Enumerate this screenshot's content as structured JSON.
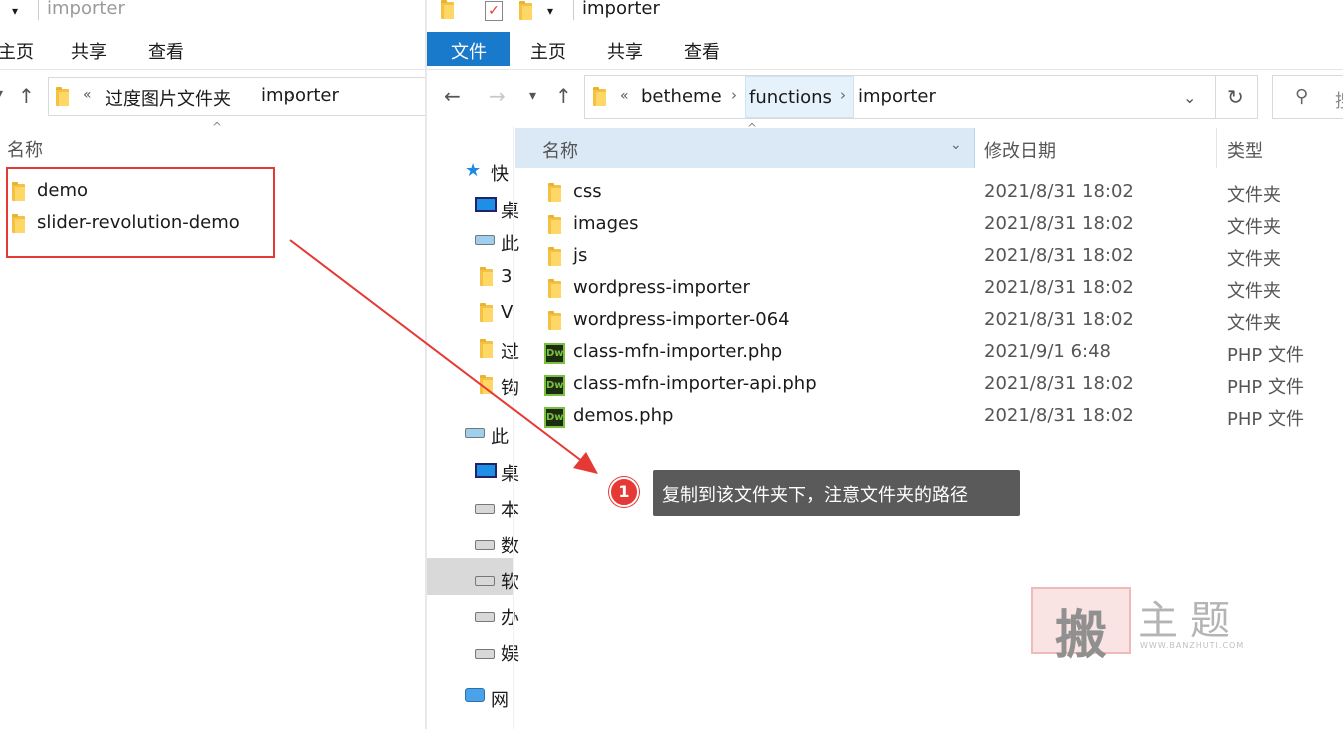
{
  "left_window": {
    "title": "importer",
    "tabs": [
      "主页",
      "共享",
      "查看"
    ],
    "breadcrumb": [
      "«",
      "过度图片文件夹",
      "importer"
    ],
    "column_header": "名称",
    "items": [
      "demo",
      "slider-revolution-demo"
    ]
  },
  "right_window": {
    "title": "importer",
    "tabs": [
      "文件",
      "主页",
      "共享",
      "查看"
    ],
    "breadcrumb": [
      "«",
      "betheme",
      "functions",
      "importer"
    ],
    "columns": {
      "name": "名称",
      "date": "修改日期",
      "type": "类型"
    },
    "search_glyph": "搜",
    "nav_pane": [
      "快",
      "桌",
      "此",
      "3",
      "V",
      "过",
      "钩",
      "此",
      "桌",
      "本",
      "数",
      "软",
      "办",
      "娱",
      "网"
    ],
    "files": [
      {
        "name": "css",
        "date": "2021/8/31 18:02",
        "type": "文件夹",
        "icon": "folder-icon"
      },
      {
        "name": "images",
        "date": "2021/8/31 18:02",
        "type": "文件夹",
        "icon": "folder-icon"
      },
      {
        "name": "js",
        "date": "2021/8/31 18:02",
        "type": "文件夹",
        "icon": "folder-icon"
      },
      {
        "name": "wordpress-importer",
        "date": "2021/8/31 18:02",
        "type": "文件夹",
        "icon": "folder-icon"
      },
      {
        "name": "wordpress-importer-064",
        "date": "2021/8/31 18:02",
        "type": "文件夹",
        "icon": "folder-icon"
      },
      {
        "name": "class-mfn-importer.php",
        "date": "2021/9/1 6:48",
        "type": "PHP 文件",
        "icon": "dreamweaver-icon"
      },
      {
        "name": "class-mfn-importer-api.php",
        "date": "2021/8/31 18:02",
        "type": "PHP 文件",
        "icon": "dreamweaver-icon"
      },
      {
        "name": "demos.php",
        "date": "2021/8/31 18:02",
        "type": "PHP 文件",
        "icon": "dreamweaver-icon"
      }
    ]
  },
  "annotation": {
    "number": "1",
    "text": "复制到该文件夹下，注意文件夹的路径"
  },
  "watermark": {
    "main": "搬",
    "sub": "主题",
    "url": "WWW.BANZHUTI.COM"
  },
  "colors": {
    "file_tab": "#1979ca",
    "header_selected": "#dbe9f6",
    "highlight_box": "#e53935",
    "callout_bg": "#5a5a5a"
  }
}
